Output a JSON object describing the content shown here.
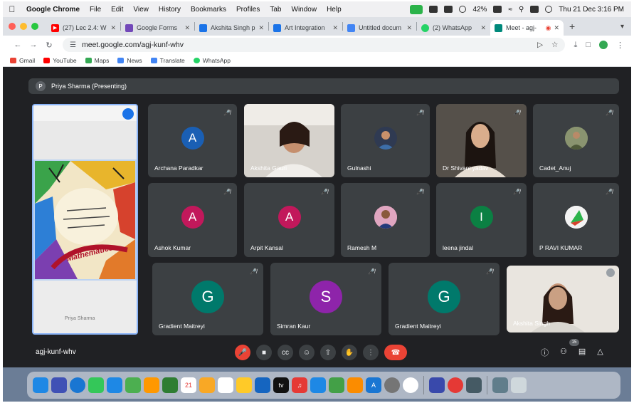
{
  "menubar": {
    "app": "Google Chrome",
    "menus": [
      "File",
      "Edit",
      "View",
      "History",
      "Bookmarks",
      "Profiles",
      "Tab",
      "Window",
      "Help"
    ],
    "battery": "42%",
    "datetime": "Thu 21 Dec  3:16 PM"
  },
  "tabs": [
    {
      "title": "(27) Lec 2.4: W",
      "color": "#ff0000",
      "active": false
    },
    {
      "title": "Google Forms",
      "color": "#7248b9",
      "active": false
    },
    {
      "title": "Akshita Singh p",
      "color": "#1a73e8",
      "active": false
    },
    {
      "title": "Art Integration",
      "color": "#1a73e8",
      "active": false
    },
    {
      "title": "Untitled docum",
      "color": "#4285f4",
      "active": false
    },
    {
      "title": "(2) WhatsApp",
      "color": "#25d366",
      "active": false
    },
    {
      "title": "Meet - agj-",
      "color": "#00897b",
      "active": true
    }
  ],
  "address": {
    "url": "meet.google.com/agj-kunf-whv"
  },
  "bookmarks": [
    {
      "label": "Gmail",
      "color": "#ea4335"
    },
    {
      "label": "YouTube",
      "color": "#ff0000"
    },
    {
      "label": "Maps",
      "color": "#34a853"
    },
    {
      "label": "News",
      "color": "#4285f4"
    },
    {
      "label": "Translate",
      "color": "#4285f4"
    },
    {
      "label": "WhatsApp",
      "color": "#25d366"
    }
  ],
  "meet": {
    "presenter": "Priya Sharma (Presenting)",
    "presenter_initial": "P",
    "screen_caption": "Mathematics",
    "screen_bottom_text": "Priya Sharma",
    "meeting_code": "agj-kunf-whv",
    "participant_count": "15",
    "tiles": [
      {
        "name": "Archana Paradkar",
        "initial": "A",
        "color": "#1a5fb4",
        "kind": "initial"
      },
      {
        "name": "Akshita Gauri",
        "kind": "video"
      },
      {
        "name": "Gulnashi",
        "kind": "pic"
      },
      {
        "name": "Dr Shivani yadav",
        "kind": "video2"
      },
      {
        "name": "Cadet_Anuj",
        "kind": "pic2"
      },
      {
        "name": "Ashok Kumar",
        "initial": "A",
        "color": "#c2185b",
        "kind": "initial"
      },
      {
        "name": "Arpit Kansal",
        "initial": "A",
        "color": "#c2185b",
        "kind": "initial"
      },
      {
        "name": "Ramesh M",
        "kind": "pic3"
      },
      {
        "name": "leena jindal",
        "initial": "I",
        "color": "#0b8043",
        "kind": "initial"
      },
      {
        "name": "P RAVI KUMAR",
        "kind": "pic4"
      },
      {
        "name": "Gradient Maitreyi",
        "initial": "G",
        "color": "#00796b",
        "kind": "initial"
      },
      {
        "name": "Simran Kaur",
        "initial": "S",
        "color": "#8e24aa",
        "kind": "initial"
      },
      {
        "name": "Gradient Maitreyi",
        "initial": "G",
        "color": "#00796b",
        "kind": "initial"
      },
      {
        "name": "Akshita Singh",
        "kind": "video3"
      }
    ]
  }
}
